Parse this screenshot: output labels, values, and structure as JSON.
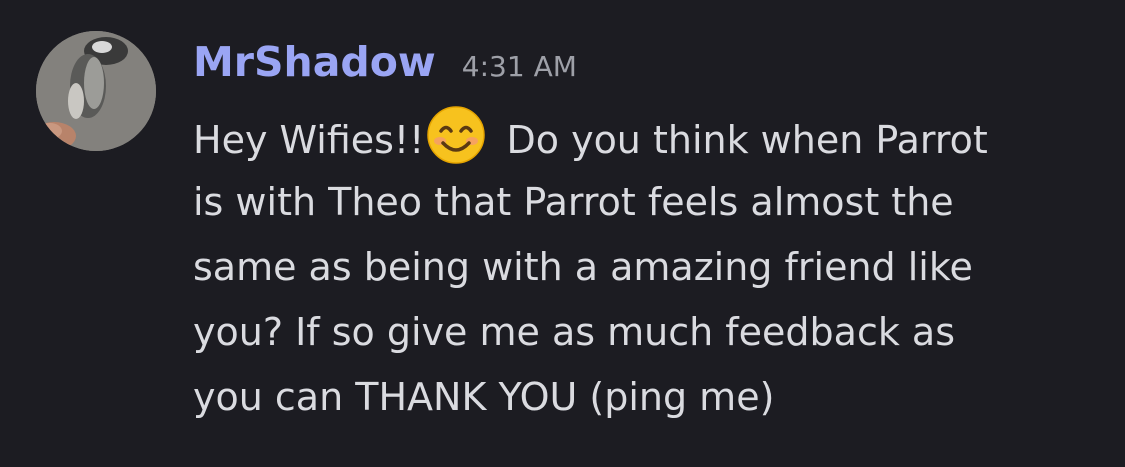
{
  "message": {
    "username": "MrShadow",
    "timestamp": "4:31 AM",
    "lines": [
      {
        "before_emoji": "Hey Wifies!!",
        "emoji": "smiling-face-with-smiling-eyes",
        "after_emoji": " Do you think when Parrot"
      },
      {
        "text": "is with Theo that Parrot feels almost the"
      },
      {
        "text": "same as being with a amazing friend like"
      },
      {
        "text": "you? If so give me as much feedback as"
      },
      {
        "text": "you can THANK YOU (ping me)"
      }
    ]
  },
  "colors": {
    "background": "#1c1c22",
    "username": "#9aa5f4",
    "timestamp": "#9ea0a8",
    "text": "#dadbe0"
  }
}
